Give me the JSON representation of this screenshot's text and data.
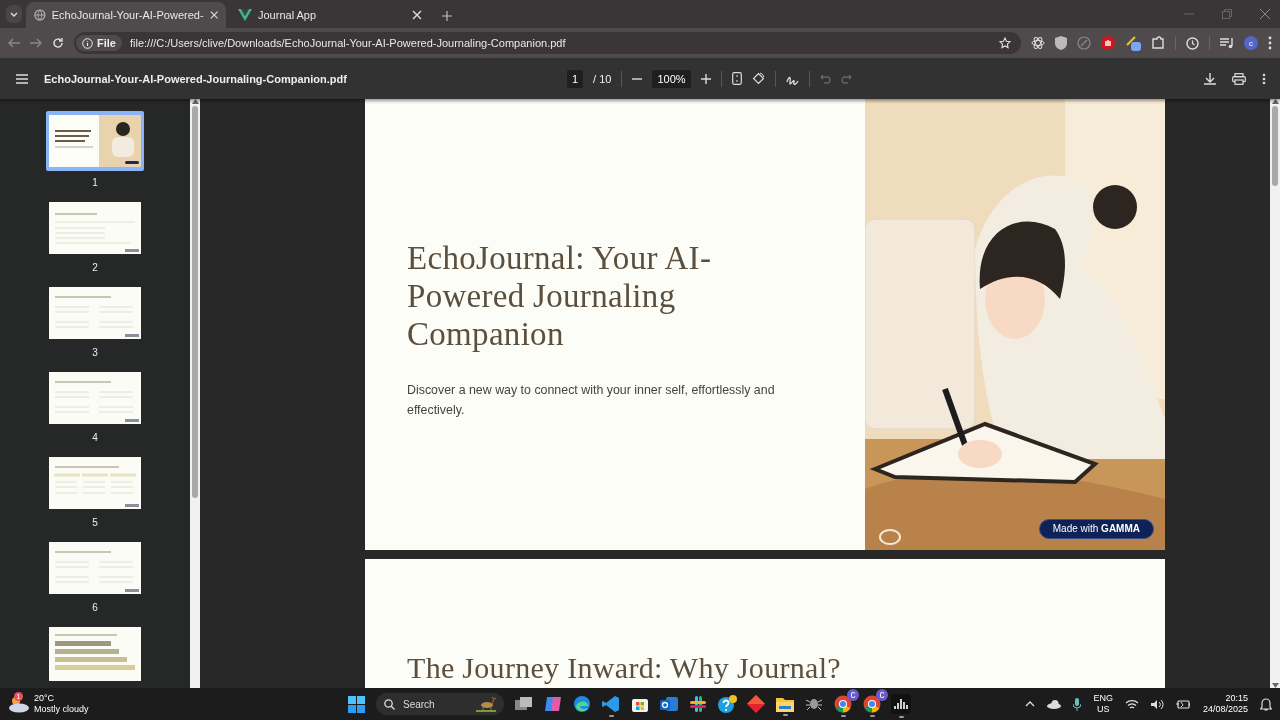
{
  "browser": {
    "tabs": [
      {
        "title": "EchoJournal-Your-AI-Powered-",
        "selected": true,
        "kind": "globe"
      },
      {
        "title": "Journal App",
        "selected": false,
        "kind": "v"
      }
    ],
    "address": {
      "scheme": "File",
      "url": "file:///C:/Users/clive/Downloads/EchoJournal-Your-AI-Powered-Journaling-Companion.pdf"
    },
    "profile_initial": "c"
  },
  "pdf_toolbar": {
    "filename": "EchoJournal-Your-AI-Powered-Journaling-Companion.pdf",
    "page": "1",
    "page_count": "/ 10",
    "zoom": "100%"
  },
  "thumbnails": [
    {
      "label": "1",
      "selected": true,
      "kind": "title"
    },
    {
      "label": "2",
      "selected": false,
      "kind": "text"
    },
    {
      "label": "3",
      "selected": false,
      "kind": "grid"
    },
    {
      "label": "4",
      "selected": false,
      "kind": "grid"
    },
    {
      "label": "5",
      "selected": false,
      "kind": "columns"
    },
    {
      "label": "6",
      "selected": false,
      "kind": "grid"
    },
    {
      "selected": false,
      "kind": "bars"
    }
  ],
  "pages": [
    {
      "title": "EchoJournal: Your AI-Powered Journaling Companion",
      "subtitle": "Discover a new way to connect with your inner self, effortlessly and effectively.",
      "badge": "Made with **GAMMA**"
    },
    {
      "title": "The Journey Inward: Why Journal?"
    }
  ],
  "taskbar": {
    "weather": {
      "badge": "1",
      "temperature": "20°C",
      "condition": "Mostly cloudy"
    },
    "search": {
      "placeholder": "Search"
    },
    "apps": [
      {
        "kind": "taskview",
        "running": false
      },
      {
        "kind": "copilot",
        "running": false
      },
      {
        "kind": "edge",
        "running": false
      },
      {
        "kind": "vscode",
        "running": true
      },
      {
        "kind": "store",
        "running": false
      },
      {
        "kind": "mail",
        "running": false
      },
      {
        "kind": "slack",
        "running": false
      },
      {
        "kind": "help",
        "running": false
      },
      {
        "kind": "diamond",
        "running": false
      },
      {
        "kind": "folder",
        "running": true
      },
      {
        "kind": "bug",
        "running": false
      },
      {
        "kind": "chrome",
        "running": true,
        "badge": "c"
      },
      {
        "kind": "chrome",
        "running": true,
        "badge": "c"
      },
      {
        "kind": "audio",
        "running": true
      }
    ],
    "tray": {
      "language": "ENG",
      "region": "US",
      "time": "20:15",
      "date": "24/08/2025"
    }
  }
}
